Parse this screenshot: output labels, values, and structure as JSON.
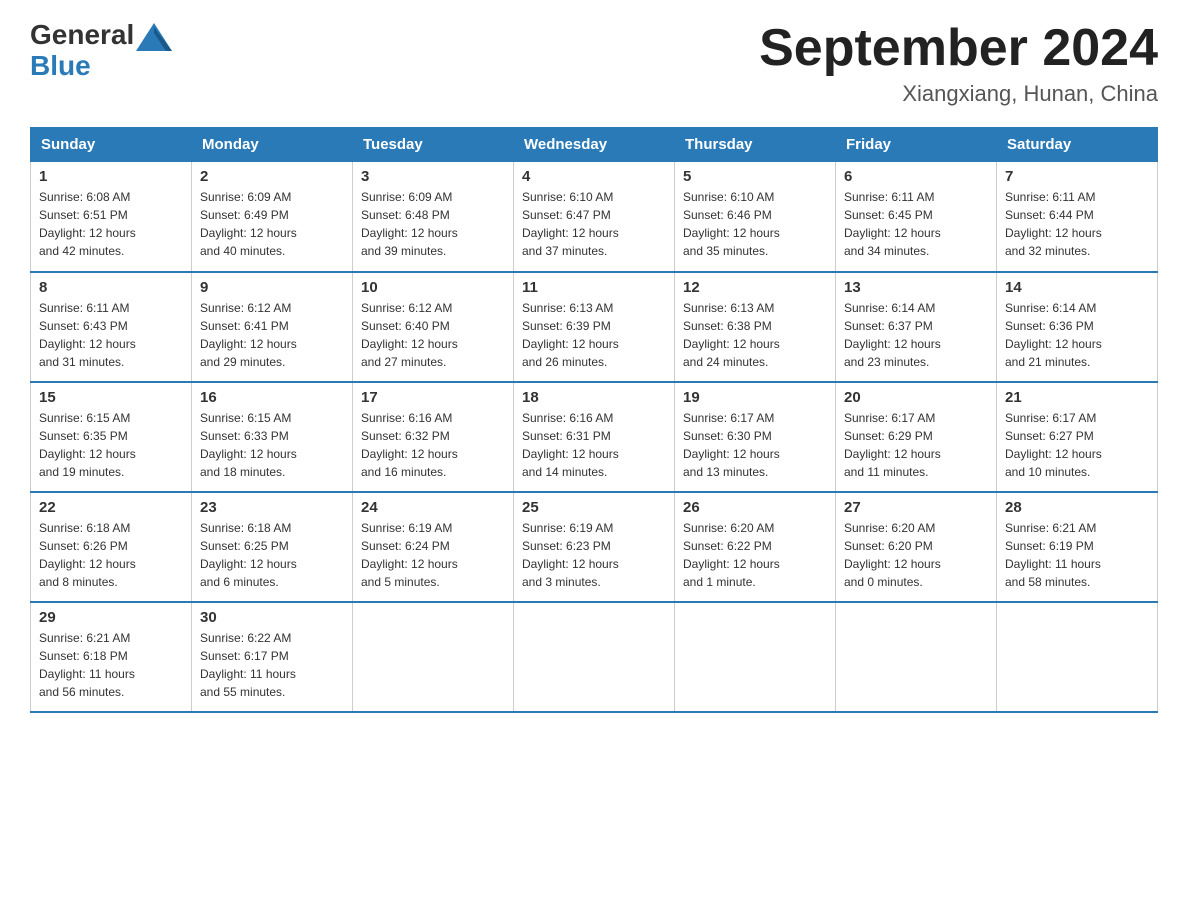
{
  "header": {
    "logo_general": "General",
    "logo_blue": "Blue",
    "title": "September 2024",
    "subtitle": "Xiangxiang, Hunan, China"
  },
  "days_of_week": [
    "Sunday",
    "Monday",
    "Tuesday",
    "Wednesday",
    "Thursday",
    "Friday",
    "Saturday"
  ],
  "weeks": [
    [
      {
        "day": "1",
        "info": "Sunrise: 6:08 AM\nSunset: 6:51 PM\nDaylight: 12 hours\nand 42 minutes."
      },
      {
        "day": "2",
        "info": "Sunrise: 6:09 AM\nSunset: 6:49 PM\nDaylight: 12 hours\nand 40 minutes."
      },
      {
        "day": "3",
        "info": "Sunrise: 6:09 AM\nSunset: 6:48 PM\nDaylight: 12 hours\nand 39 minutes."
      },
      {
        "day": "4",
        "info": "Sunrise: 6:10 AM\nSunset: 6:47 PM\nDaylight: 12 hours\nand 37 minutes."
      },
      {
        "day": "5",
        "info": "Sunrise: 6:10 AM\nSunset: 6:46 PM\nDaylight: 12 hours\nand 35 minutes."
      },
      {
        "day": "6",
        "info": "Sunrise: 6:11 AM\nSunset: 6:45 PM\nDaylight: 12 hours\nand 34 minutes."
      },
      {
        "day": "7",
        "info": "Sunrise: 6:11 AM\nSunset: 6:44 PM\nDaylight: 12 hours\nand 32 minutes."
      }
    ],
    [
      {
        "day": "8",
        "info": "Sunrise: 6:11 AM\nSunset: 6:43 PM\nDaylight: 12 hours\nand 31 minutes."
      },
      {
        "day": "9",
        "info": "Sunrise: 6:12 AM\nSunset: 6:41 PM\nDaylight: 12 hours\nand 29 minutes."
      },
      {
        "day": "10",
        "info": "Sunrise: 6:12 AM\nSunset: 6:40 PM\nDaylight: 12 hours\nand 27 minutes."
      },
      {
        "day": "11",
        "info": "Sunrise: 6:13 AM\nSunset: 6:39 PM\nDaylight: 12 hours\nand 26 minutes."
      },
      {
        "day": "12",
        "info": "Sunrise: 6:13 AM\nSunset: 6:38 PM\nDaylight: 12 hours\nand 24 minutes."
      },
      {
        "day": "13",
        "info": "Sunrise: 6:14 AM\nSunset: 6:37 PM\nDaylight: 12 hours\nand 23 minutes."
      },
      {
        "day": "14",
        "info": "Sunrise: 6:14 AM\nSunset: 6:36 PM\nDaylight: 12 hours\nand 21 minutes."
      }
    ],
    [
      {
        "day": "15",
        "info": "Sunrise: 6:15 AM\nSunset: 6:35 PM\nDaylight: 12 hours\nand 19 minutes."
      },
      {
        "day": "16",
        "info": "Sunrise: 6:15 AM\nSunset: 6:33 PM\nDaylight: 12 hours\nand 18 minutes."
      },
      {
        "day": "17",
        "info": "Sunrise: 6:16 AM\nSunset: 6:32 PM\nDaylight: 12 hours\nand 16 minutes."
      },
      {
        "day": "18",
        "info": "Sunrise: 6:16 AM\nSunset: 6:31 PM\nDaylight: 12 hours\nand 14 minutes."
      },
      {
        "day": "19",
        "info": "Sunrise: 6:17 AM\nSunset: 6:30 PM\nDaylight: 12 hours\nand 13 minutes."
      },
      {
        "day": "20",
        "info": "Sunrise: 6:17 AM\nSunset: 6:29 PM\nDaylight: 12 hours\nand 11 minutes."
      },
      {
        "day": "21",
        "info": "Sunrise: 6:17 AM\nSunset: 6:27 PM\nDaylight: 12 hours\nand 10 minutes."
      }
    ],
    [
      {
        "day": "22",
        "info": "Sunrise: 6:18 AM\nSunset: 6:26 PM\nDaylight: 12 hours\nand 8 minutes."
      },
      {
        "day": "23",
        "info": "Sunrise: 6:18 AM\nSunset: 6:25 PM\nDaylight: 12 hours\nand 6 minutes."
      },
      {
        "day": "24",
        "info": "Sunrise: 6:19 AM\nSunset: 6:24 PM\nDaylight: 12 hours\nand 5 minutes."
      },
      {
        "day": "25",
        "info": "Sunrise: 6:19 AM\nSunset: 6:23 PM\nDaylight: 12 hours\nand 3 minutes."
      },
      {
        "day": "26",
        "info": "Sunrise: 6:20 AM\nSunset: 6:22 PM\nDaylight: 12 hours\nand 1 minute."
      },
      {
        "day": "27",
        "info": "Sunrise: 6:20 AM\nSunset: 6:20 PM\nDaylight: 12 hours\nand 0 minutes."
      },
      {
        "day": "28",
        "info": "Sunrise: 6:21 AM\nSunset: 6:19 PM\nDaylight: 11 hours\nand 58 minutes."
      }
    ],
    [
      {
        "day": "29",
        "info": "Sunrise: 6:21 AM\nSunset: 6:18 PM\nDaylight: 11 hours\nand 56 minutes."
      },
      {
        "day": "30",
        "info": "Sunrise: 6:22 AM\nSunset: 6:17 PM\nDaylight: 11 hours\nand 55 minutes."
      },
      {
        "day": "",
        "info": ""
      },
      {
        "day": "",
        "info": ""
      },
      {
        "day": "",
        "info": ""
      },
      {
        "day": "",
        "info": ""
      },
      {
        "day": "",
        "info": ""
      }
    ]
  ]
}
